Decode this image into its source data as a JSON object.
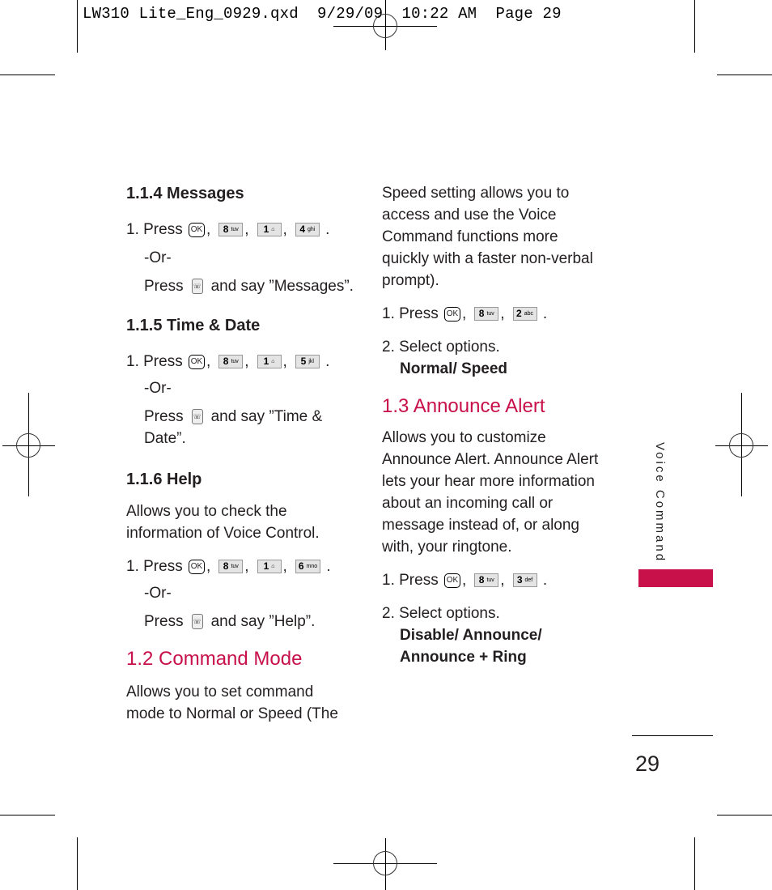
{
  "slug_line": "LW310 Lite_Eng_0929.qxd  9/29/09  10:22 AM  Page 29",
  "left_column": {
    "sections": [
      {
        "heading": "1.1.4 Messages",
        "step_prefix": "1. Press",
        "keys": [
          {
            "type": "ok",
            "label": "OK"
          },
          {
            "type": "num",
            "digit": "8",
            "letters": "tuv"
          },
          {
            "type": "num",
            "digit": "1",
            "letters": "vm"
          },
          {
            "type": "num",
            "digit": "4",
            "letters": "ghi"
          }
        ],
        "or_label": "-Or-",
        "alt_prefix": "Press",
        "alt_suffix": "and say ”Messages”."
      },
      {
        "heading": "1.1.5 Time & Date",
        "step_prefix": "1. Press",
        "keys": [
          {
            "type": "ok",
            "label": "OK"
          },
          {
            "type": "num",
            "digit": "8",
            "letters": "tuv"
          },
          {
            "type": "num",
            "digit": "1",
            "letters": "vm"
          },
          {
            "type": "num",
            "digit": "5",
            "letters": "jkl"
          }
        ],
        "or_label": "-Or-",
        "alt_prefix": "Press",
        "alt_suffix": "and say ”Time &",
        "alt_suffix_cont": "Date”."
      },
      {
        "heading": "1.1.6 Help",
        "description": [
          "Allows you to check the",
          "information of Voice Control."
        ],
        "step_prefix": "1. Press",
        "keys": [
          {
            "type": "ok",
            "label": "OK"
          },
          {
            "type": "num",
            "digit": "8",
            "letters": "tuv"
          },
          {
            "type": "num",
            "digit": "1",
            "letters": "vm"
          },
          {
            "type": "num",
            "digit": "6",
            "letters": "mno"
          }
        ],
        "or_label": "-Or-",
        "alt_prefix": "Press",
        "alt_suffix": "and say ”Help”."
      }
    ],
    "command_mode": {
      "heading": "1.2 Command Mode",
      "description": [
        "Allows you to set command",
        "mode to Normal or Speed (The"
      ]
    }
  },
  "right_column": {
    "command_mode_cont": [
      "Speed setting allows you to",
      "access and use the Voice",
      "Command functions more",
      "quickly with a faster non-verbal",
      "prompt)."
    ],
    "command_mode_steps": {
      "step1_prefix": "1. Press",
      "keys": [
        {
          "type": "ok",
          "label": "OK"
        },
        {
          "type": "num",
          "digit": "8",
          "letters": "tuv"
        },
        {
          "type": "num",
          "digit": "2",
          "letters": "abc"
        }
      ],
      "step2": "2. Select options.",
      "options": "Normal/ Speed"
    },
    "announce_alert": {
      "heading": "1.3 Announce Alert",
      "description": [
        "Allows you to customize",
        "Announce Alert. Announce Alert",
        "lets your hear more information",
        "about an incoming call or",
        "message instead of, or along",
        "with, your ringtone."
      ],
      "step1_prefix": "1. Press",
      "keys": [
        {
          "type": "ok",
          "label": "OK"
        },
        {
          "type": "num",
          "digit": "8",
          "letters": "tuv"
        },
        {
          "type": "num",
          "digit": "3",
          "letters": "def"
        }
      ],
      "step2": "2. Select options.",
      "options": [
        "Disable/ Announce/",
        "Announce + Ring"
      ]
    }
  },
  "side_tab_label": "Voice Command",
  "page_number": "29",
  "colors": {
    "accent": "#c8104a",
    "text": "#231f20"
  }
}
